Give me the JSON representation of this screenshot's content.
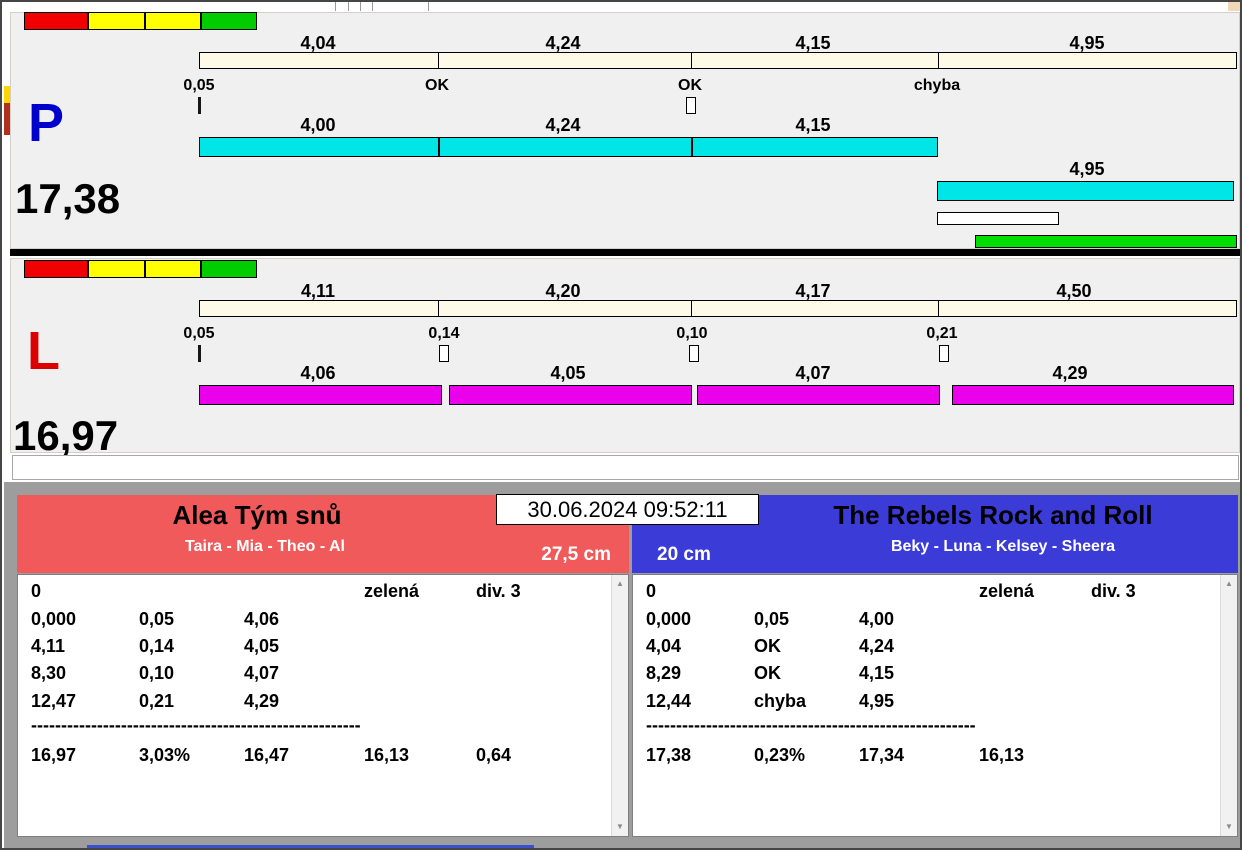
{
  "status_lights": {
    "colors": [
      "#f00000",
      "#ffff00",
      "#ffff00",
      "#00cc00"
    ]
  },
  "lane_p": {
    "letter": "P",
    "letter_color": "#0000cc",
    "total_time": "17,38",
    "ruler_values": [
      "4,04",
      "4,24",
      "4,15",
      "4,95"
    ],
    "change_labels": [
      "0,05",
      "OK",
      "OK",
      "chyba"
    ],
    "bar_values": [
      "4,00",
      "4,24",
      "4,15"
    ],
    "overflow_value": "4,95",
    "bar_color": "#00e6e6"
  },
  "lane_l": {
    "letter": "L",
    "letter_color": "#dd0000",
    "total_time": "16,97",
    "ruler_values": [
      "4,11",
      "4,20",
      "4,17",
      "4,50"
    ],
    "change_labels": [
      "0,05",
      "0,14",
      "0,10",
      "0,21"
    ],
    "bar_values": [
      "4,06",
      "4,05",
      "4,07",
      "4,29"
    ],
    "bar_color": "#ea00ea"
  },
  "scoreboard": {
    "datetime": "30.06.2024 09:52:11",
    "team_left": {
      "name": "Alea Tým snů",
      "members": "Taira - Mia - Theo - Al",
      "jump_height": "27,5 cm",
      "color": "#f05a5a"
    },
    "team_right": {
      "name": "The Rebels Rock and Roll",
      "members": "Beky - Luna - Kelsey - Sheera",
      "jump_height": "20 cm",
      "color": "#3b3bd8"
    },
    "results_left": {
      "start_value": "0",
      "card_color": "zelená",
      "division": "div. 3",
      "rows": [
        [
          "0,000",
          "0,05",
          "4,06"
        ],
        [
          "4,11",
          "0,14",
          "4,05"
        ],
        [
          "8,30",
          "0,10",
          "4,07"
        ],
        [
          "12,47",
          "0,21",
          "4,29"
        ]
      ],
      "divider": "-------------------------------------------------------",
      "summary": [
        "16,97",
        "3,03%",
        "16,47",
        "16,13",
        "0,64"
      ]
    },
    "results_right": {
      "start_value": "0",
      "card_color": "zelená",
      "division": "div. 3",
      "rows": [
        [
          "0,000",
          "0,05",
          "4,00"
        ],
        [
          "4,04",
          "OK",
          "4,24"
        ],
        [
          "8,29",
          "OK",
          "4,15"
        ],
        [
          "12,44",
          "chyba",
          "4,95"
        ]
      ],
      "divider": "-------------------------------------------------------",
      "summary": [
        "17,38",
        "0,23%",
        "17,34",
        "16,13"
      ]
    }
  }
}
